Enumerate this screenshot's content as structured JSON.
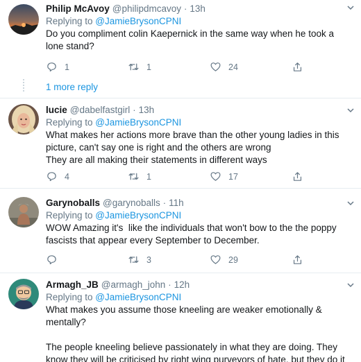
{
  "tweets": [
    {
      "name": "Philip McAvoy",
      "handle": "@philipdmcavoy",
      "time": "13h",
      "reply_prefix": "Replying to ",
      "reply_to": "@JamieBrysonCPNI",
      "text": "Do you compliment colin Kaepernick in the same way when he took a lone stand?",
      "replies": "1",
      "retweets": "1",
      "likes": "24"
    },
    {
      "name": "lucie",
      "handle": "@dabelfastgirl",
      "time": "13h",
      "reply_prefix": "Replying to ",
      "reply_to": "@JamieBrysonCPNI",
      "text": "What makes her actions more brave than the other young ladies in this picture, can't say one is right and the others are wrong\nThey are all making their statements in different ways",
      "replies": "4",
      "retweets": "1",
      "likes": "17"
    },
    {
      "name": "Garynoballs",
      "handle": "@garynoballs",
      "time": "11h",
      "reply_prefix": "Replying to ",
      "reply_to": "@JamieBrysonCPNI",
      "text": "WOW Amazing it's  like the individuals that won't bow to the the poppy fascists that appear every September to December.",
      "replies": "",
      "retweets": "3",
      "likes": "29"
    },
    {
      "name": "Armagh_JB",
      "handle": "@armagh_john",
      "time": "12h",
      "reply_prefix": "Replying to ",
      "reply_to": "@JamieBrysonCPNI",
      "text": "What makes you assume those kneeling are weaker emotionally & mentally?\n\nThe people kneeling believe passionately in what they are doing. They know they will be criticised by right wing purveyors of hate, but they do it anyway.",
      "replies": "",
      "retweets": "",
      "likes": ""
    }
  ],
  "more_reply_label": "1 more reply",
  "time_separator": "·",
  "colors": {
    "link": "#1b95e0",
    "muted": "#657786",
    "text": "#14171a",
    "divider": "#e6ecf0"
  },
  "icons": {
    "reply": "reply-icon",
    "retweet": "retweet-icon",
    "like": "heart-icon",
    "share": "share-icon",
    "caret": "chevron-down-icon"
  }
}
